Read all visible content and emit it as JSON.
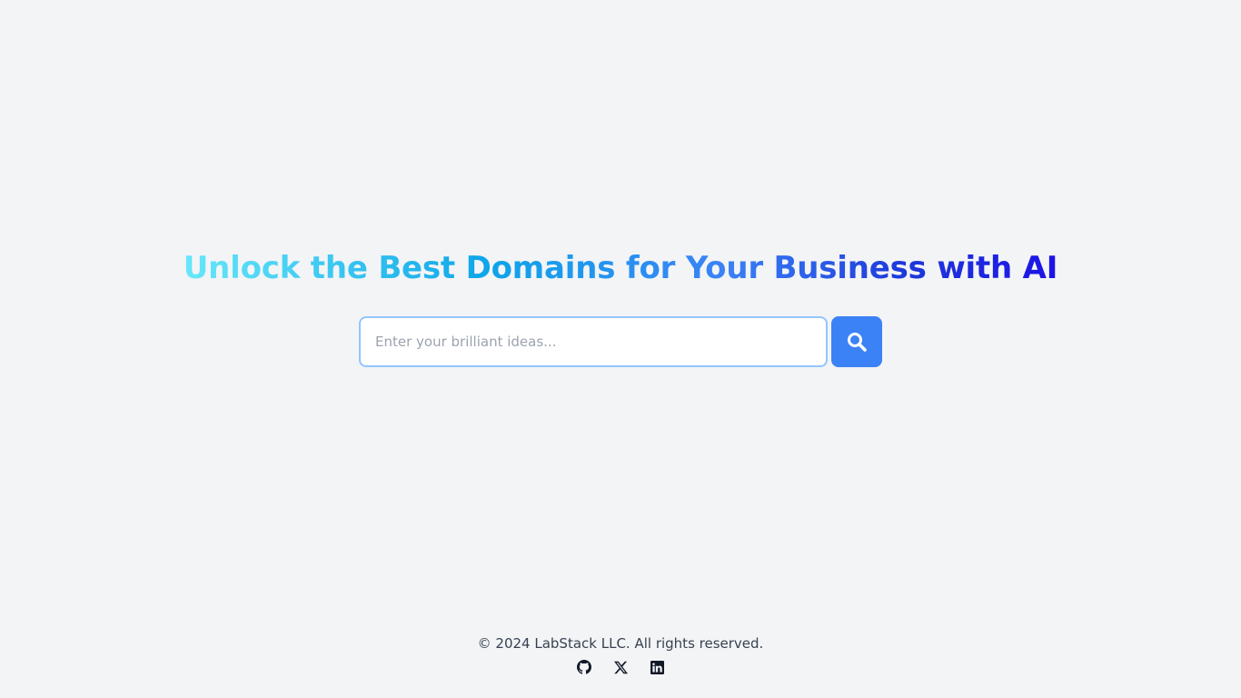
{
  "hero": {
    "title": "Unlock the Best Domains for Your Business with AI"
  },
  "search": {
    "placeholder": "Enter your brilliant ideas...",
    "value": "",
    "button_icon": "search-icon"
  },
  "footer": {
    "copyright": "© 2024 LabStack LLC. All rights reserved.",
    "social": [
      {
        "icon": "github-icon"
      },
      {
        "icon": "x-icon"
      },
      {
        "icon": "linkedin-icon"
      }
    ]
  },
  "colors": {
    "background": "#f3f4f6",
    "accent": "#3b82f6",
    "input_border": "#93c5fd",
    "gradient_start": "#67e8f9",
    "gradient_end": "#1d12e6",
    "footer_text": "#374151"
  }
}
